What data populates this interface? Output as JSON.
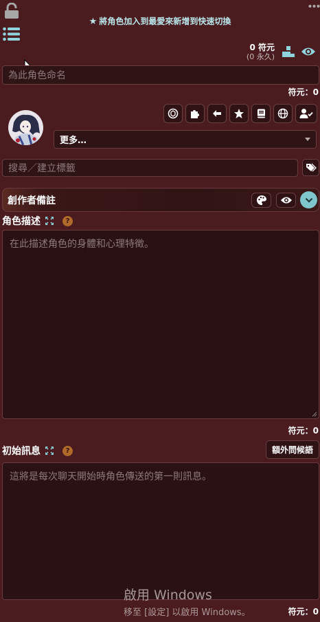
{
  "top": {
    "favorite_tip": "將角色加入到最愛來新增到快速切換",
    "tokens_main": "0 符元",
    "tokens_permanent": "(0 永久)"
  },
  "name_input": {
    "placeholder": "為此角色命名"
  },
  "token_label": "符元：0",
  "toolbar": {
    "icons": [
      "openai-icon",
      "puzzle-icon",
      "arrow-left-icon",
      "star-icon",
      "book-icon",
      "globe-icon",
      "user-check-icon"
    ]
  },
  "more_select": {
    "value": "更多…"
  },
  "tags_input": {
    "placeholder": "搜尋／建立標籤"
  },
  "creator_notes": {
    "title": "創作者備註"
  },
  "description": {
    "label": "角色描述",
    "placeholder": "在此描述角色的身體和心理特徵。",
    "token_label": "符元：0"
  },
  "first_message": {
    "label": "初始訊息",
    "alt_greetings_button": "額外問候語",
    "placeholder": "這將是每次聊天開始時角色傳送的第一則訊息。",
    "token_label": "符元：0"
  },
  "help_glyph": "?",
  "watermark": {
    "line1": "啟用 Windows",
    "line2": "移至 [設定] 以啟用 Windows。"
  },
  "colors": {
    "background": "#4a1c1f",
    "accent": "#7fc5cc",
    "help": "#b06a2a"
  }
}
